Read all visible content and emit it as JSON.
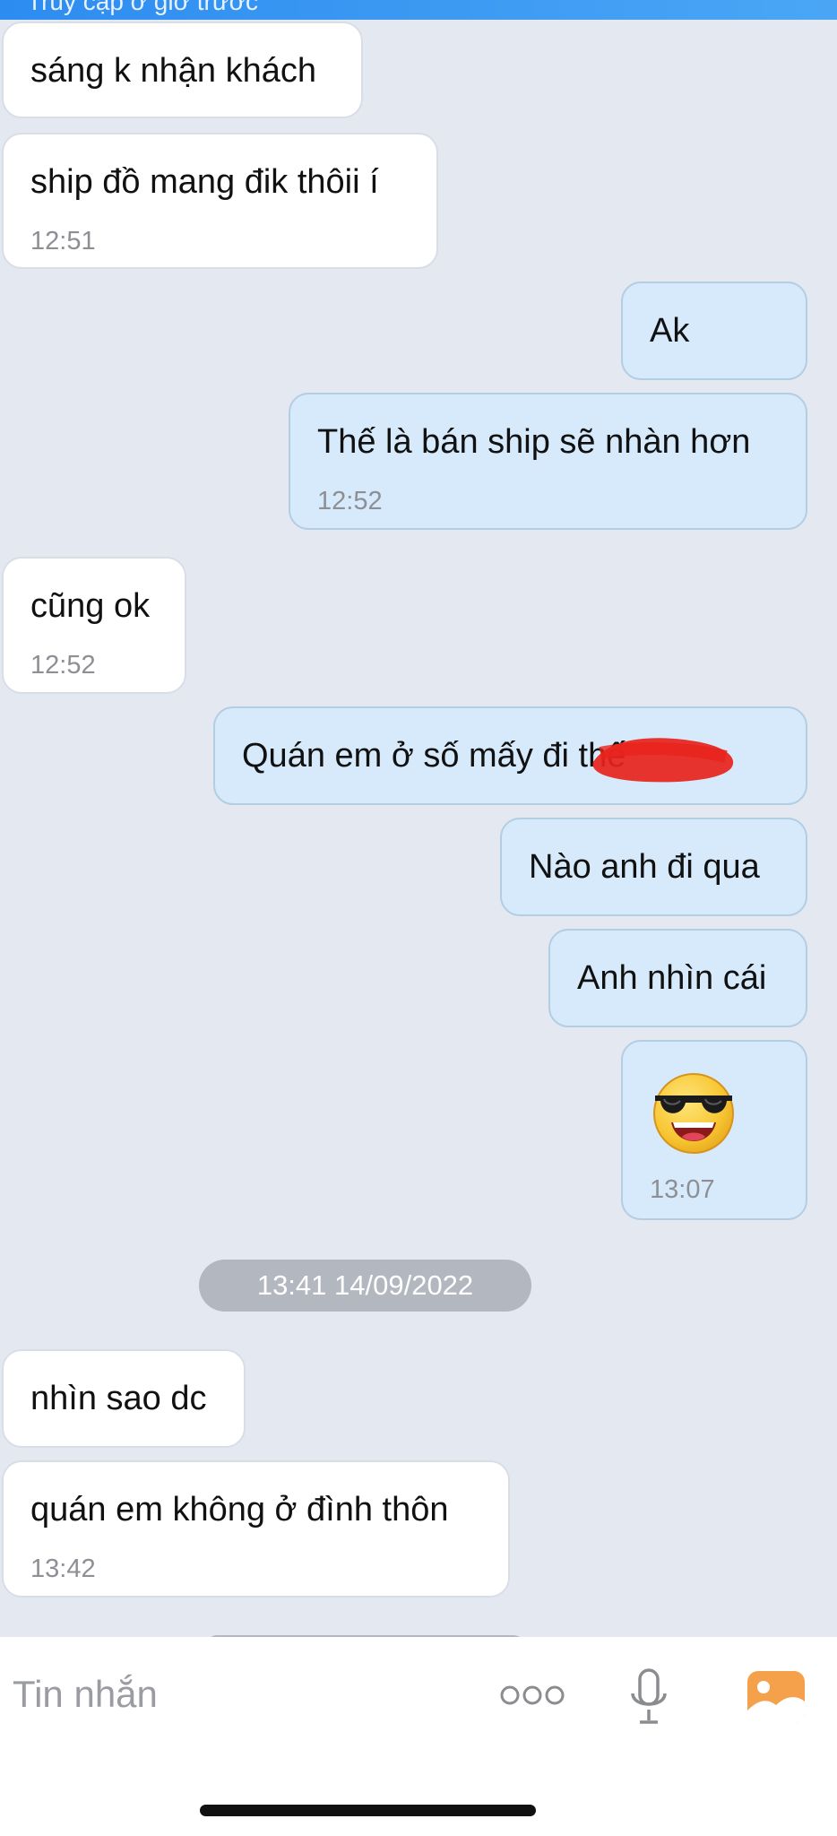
{
  "status_strip": {
    "text": "Truy cập ở giờ trước"
  },
  "messages": [
    {
      "dir": "in",
      "text": "sáng k nhận khách",
      "time": null
    },
    {
      "dir": "in",
      "text": "ship đồ mang đik thôii í",
      "time": "12:51"
    },
    {
      "dir": "out",
      "text": "Ak",
      "time": null
    },
    {
      "dir": "out",
      "text": "Thế là bán ship sẽ nhàn hơn",
      "time": "12:52"
    },
    {
      "dir": "in",
      "text": "cũng ok",
      "time": "12:52"
    },
    {
      "dir": "out",
      "text": "Quán em ở số mấy đi   thế",
      "time": null,
      "note": "partially redacted with red marker"
    },
    {
      "dir": "out",
      "text": "Nào anh đi qua",
      "time": null
    },
    {
      "dir": "out",
      "text": "Anh nhìn cái",
      "time": null
    },
    {
      "dir": "out",
      "sticker": "sunglasses-emoji",
      "time": "13:07"
    },
    {
      "dir": "in",
      "text": "nhìn sao dc",
      "time": null
    },
    {
      "dir": "in",
      "text": "quán em không ở đình thôn",
      "time": "13:42"
    }
  ],
  "date_separator": "13:41 14/09/2022",
  "input": {
    "placeholder": "Tin nhắn"
  },
  "toolbar": {
    "more_icon": "more-dots-icon",
    "mic_icon": "microphone-icon",
    "image_icon": "image-gallery-icon"
  },
  "colors": {
    "background": "#e4e8f1",
    "incoming_bubble": "#ffffff",
    "outgoing_bubble": "#d6eafb",
    "timestamp": "#8d8f94",
    "image_icon_accent": "#f5a04a",
    "redaction": "#e8231b"
  }
}
